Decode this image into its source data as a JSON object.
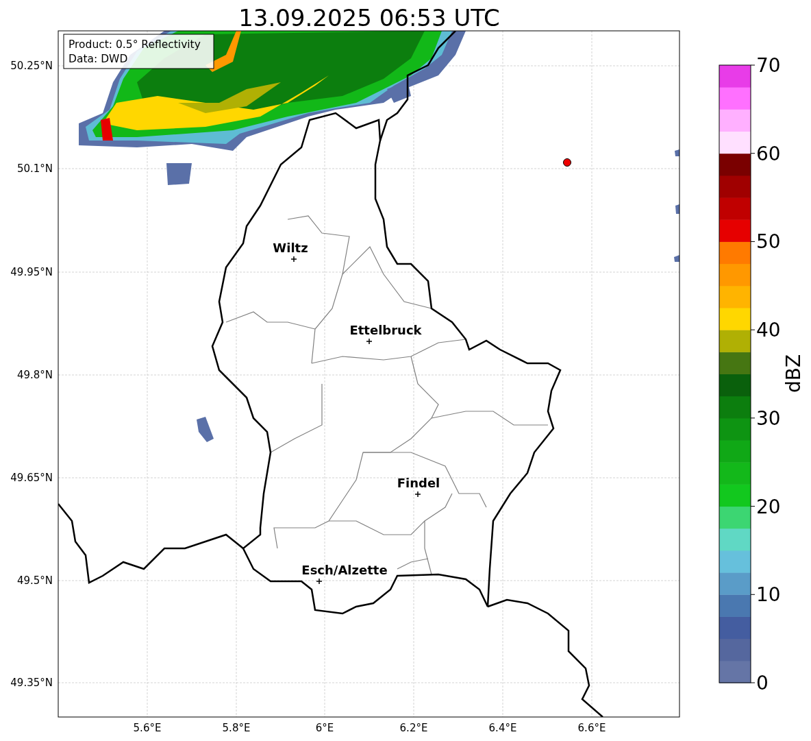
{
  "title": "13.09.2025 06:53 UTC",
  "info_box": {
    "lines": [
      "Product: 0.5° Reflectivity",
      "Data: DWD"
    ]
  },
  "map": {
    "y_ticks": [
      "50.25°N",
      "50.1°N",
      "49.95°N",
      "49.8°N",
      "49.65°N",
      "49.5°N",
      "49.35°N"
    ],
    "x_ticks": [
      "5.6°E",
      "5.8°E",
      "6°E",
      "6.2°E",
      "6.4°E",
      "6.6°E"
    ],
    "places": [
      {
        "name": "Wiltz"
      },
      {
        "name": "Ettelbruck"
      },
      {
        "name": "Findel"
      },
      {
        "name": "Esch/Alzette"
      }
    ]
  },
  "colorbar": {
    "label": "dBZ",
    "ticks": [
      "70",
      "60",
      "50",
      "40",
      "30",
      "20",
      "10",
      "0"
    ],
    "bins": [
      {
        "color": "#6575a6"
      },
      {
        "color": "#55679e"
      },
      {
        "color": "#445da0"
      },
      {
        "color": "#4a78b0"
      },
      {
        "color": "#5a9cc8"
      },
      {
        "color": "#66c0dc"
      },
      {
        "color": "#60d8c4"
      },
      {
        "color": "#3cd672"
      },
      {
        "color": "#12c81e"
      },
      {
        "color": "#13b81a"
      },
      {
        "color": "#10a816"
      },
      {
        "color": "#0e9412"
      },
      {
        "color": "#0c7e0e"
      },
      {
        "color": "#0a600c"
      },
      {
        "color": "#467612"
      },
      {
        "color": "#b0b004"
      },
      {
        "color": "#ffd700"
      },
      {
        "color": "#ffb400"
      },
      {
        "color": "#ff9800"
      },
      {
        "color": "#ff7a00"
      },
      {
        "color": "#e60000"
      },
      {
        "color": "#c00000"
      },
      {
        "color": "#a00000"
      },
      {
        "color": "#7a0000"
      },
      {
        "color": "#ffe0ff"
      },
      {
        "color": "#ffb0ff"
      },
      {
        "color": "#ff70ff"
      },
      {
        "color": "#e83ce8"
      }
    ]
  }
}
